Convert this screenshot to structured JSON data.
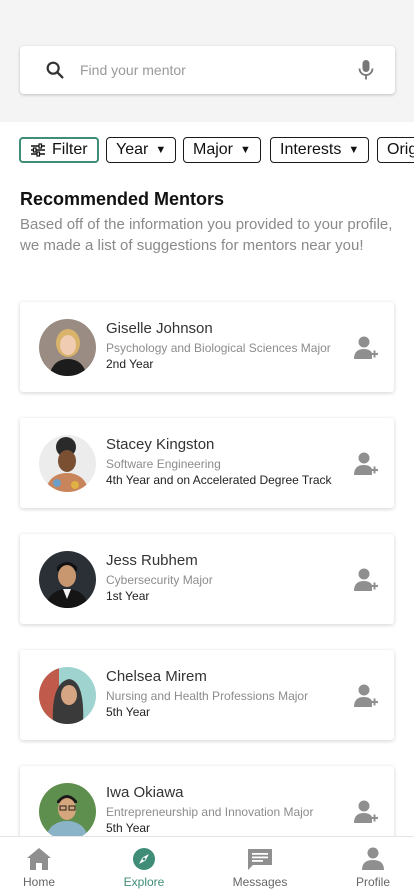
{
  "search": {
    "placeholder": "Find your mentor",
    "icon": "search-icon",
    "mic_icon": "microphone-icon"
  },
  "chips": [
    {
      "label": "Filter",
      "icon": "filter-sliders-icon"
    },
    {
      "label": "Year"
    },
    {
      "label": "Major"
    },
    {
      "label": "Interests"
    },
    {
      "label": "Orig"
    }
  ],
  "section": {
    "title": "Recommended Mentors",
    "description": "Based off of the information you provided to your profile, we made a list of suggestions for mentors near you!"
  },
  "mentors": [
    {
      "name": "Giselle Johnson",
      "major": "Psychology and Biological Sciences Major",
      "year": "2nd Year"
    },
    {
      "name": "Stacey Kingston",
      "major": "Software Engineering",
      "year": "4th Year and on Accelerated Degree Track"
    },
    {
      "name": "Jess Rubhem",
      "major": "Cybersecurity Major",
      "year": "1st Year"
    },
    {
      "name": "Chelsea Mirem",
      "major": "Nursing and Health Professions Major",
      "year": "5th Year"
    },
    {
      "name": "Iwa Okiawa",
      "major": "Entrepreneurship and Innovation Major",
      "year": "5th Year"
    }
  ],
  "nav": [
    {
      "label": "Home",
      "icon": "home-icon"
    },
    {
      "label": "Explore",
      "icon": "compass-icon",
      "active": true
    },
    {
      "label": "Messages",
      "icon": "message-icon"
    },
    {
      "label": "Profile",
      "icon": "person-icon"
    }
  ],
  "colors": {
    "accent": "#3f8c77",
    "icon_gray": "#8f8f8f",
    "background_top": "#f4f4f4"
  }
}
